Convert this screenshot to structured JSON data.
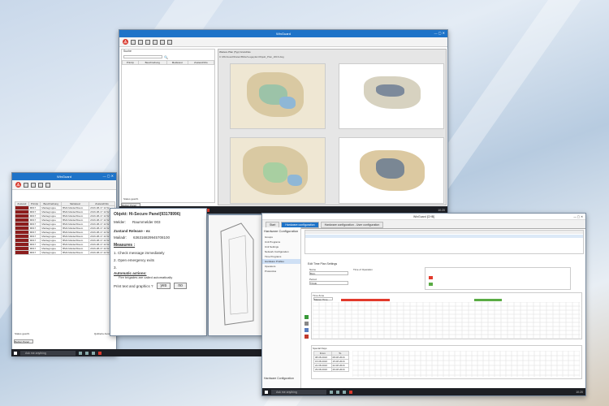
{
  "background": {
    "colors": [
      "#c9d8ea",
      "#b7cbe0",
      "#d5c9b8"
    ]
  },
  "window_maps": {
    "title": "WinGuard",
    "search_label": "Suche",
    "grid_headers": [
      "Prinzip",
      "Beschreibung",
      "Meldetext",
      "Zustand/Info"
    ],
    "footer_left": "Status geschl.",
    "panel_button": "Bedien Panel",
    "path_tab": "Weitere Plan (Typ) Grundriss",
    "path": "C:\\WinGuard\\Daten\\Bilder\\Lageplan\\Objekt_Plan_2016.dwg"
  },
  "window_alarm_list": {
    "title": "WinGuard",
    "grid_headers": [
      "Zustand",
      "Prinzip",
      "Beschreibung",
      "Meldetext",
      "Zustand/Info"
    ],
    "rows": [
      [
        "",
        "M#17",
        "Meldegruppe",
        "BMA Melder/Raum",
        "2016-08-17 11:52"
      ],
      [
        "",
        "M#17",
        "Meldegruppe",
        "BMA Melder/Raum",
        "2016-08-17 11:52"
      ],
      [
        "",
        "M#17",
        "Meldegruppe",
        "BMA Melder/Raum",
        "2016-08-17 11:52"
      ],
      [
        "",
        "M#17",
        "Meldegruppe",
        "BMA Melder/Raum",
        "2016-08-17 11:52"
      ],
      [
        "",
        "M#17",
        "Meldegruppe",
        "BMA Melder/Raum",
        "2016-08-17 11:52"
      ],
      [
        "",
        "M#17",
        "Meldegruppe",
        "BMA Melder/Raum",
        "2016-08-17 11:52"
      ],
      [
        "",
        "M#17",
        "Meldegruppe",
        "BMA Melder/Raum",
        "2016-08-17 11:52"
      ],
      [
        "",
        "M#17",
        "Meldegruppe",
        "BMA Melder/Raum",
        "2016-08-17 11:52"
      ],
      [
        "",
        "M#17",
        "Meldegruppe",
        "BMA Melder/Raum",
        "2016-08-17 11:52"
      ],
      [
        "",
        "M#17",
        "Meldegruppe",
        "BMA Melder/Raum",
        "2016-08-17 11:52"
      ],
      [
        "",
        "M#17",
        "Meldegruppe",
        "BMA Melder/Raum",
        "2016-08-17 11:52"
      ],
      [
        "",
        "M#17",
        "Meldegruppe",
        "BMA Melder/Raum",
        "2016-08-17 11:52"
      ]
    ],
    "footer_left": "Status geschl.",
    "footer_right": "Quittierte Auswahl",
    "bottom_button": "Bedien Panel"
  },
  "measures_panel": {
    "object_line": "Objekt: Hi-Secure Panel(93178996)",
    "melder_label": "Melder:",
    "melder_value": "Raummelder 003",
    "status_line": "Zustand Release - ex",
    "mailbox_label": "Mailadr:",
    "mailbox_value": "636316829945708100",
    "measures_heading": "Measures :",
    "step1": "1. Check message immediately",
    "step2": "2. Open emergency exits",
    "step3_prefix": "3.",
    "auto_heading": "Automatic actions:",
    "auto_item": "Fire brigades are called automatically",
    "prompt": "Print text and graphics ?",
    "yes_label": "yes",
    "no_label": "no"
  },
  "window_config": {
    "title": "WinGuard [CHB]",
    "tabs": [
      "Start",
      "Hardware configuration",
      "Hardware configuration - User configuration"
    ],
    "sidebar_heading": "Hardware Configuration",
    "sidebar_items": [
      "Groups",
      "Unit Programs",
      "Unit Settings",
      "Network Configuration",
      "Time Programs",
      "Hardware Profiles",
      "Operators",
      "Protocolos"
    ],
    "sidebar_footer": "Hardware Configuration",
    "edit_heading": "Edit Time Plan Settings",
    "name_label": "Name",
    "name_value": "Büro",
    "group_label": "Time of Operation",
    "period_label": "Period",
    "period_value": "TAGE",
    "gantt_title": "Time Zone",
    "gantt_select": "Master Time",
    "ranges_title": "Special Days",
    "range_col_from": "From",
    "range_col_to": "To",
    "ranges": [
      [
        "08.08.2016",
        "08.08.2016"
      ],
      [
        "15.08.2016",
        "15.08.2016"
      ],
      [
        "22.08.2016",
        "22.08.2016"
      ],
      [
        "29.08.2016",
        "29.08.2016"
      ]
    ],
    "colors": {
      "red_bar": "#e23a2c",
      "green_bar": "#5aac44"
    }
  },
  "taskbar": {
    "search_placeholder": "Ask me anything",
    "clock": "10:20"
  }
}
